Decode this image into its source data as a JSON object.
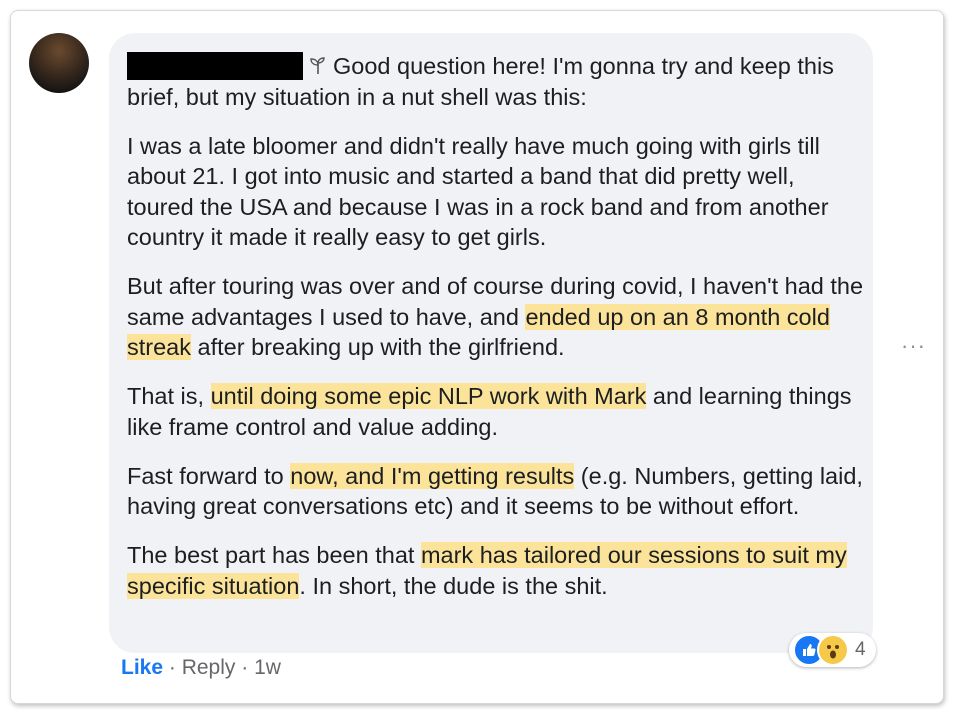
{
  "comment": {
    "author_redacted": true,
    "badge_icon": "sprout-icon",
    "paragraphs": [
      [
        {
          "text": "Good question here! I'm gonna try and keep this brief, but my situation in a nut shell was this:",
          "hl": false
        }
      ],
      [
        {
          "text": "I was a late bloomer and didn't really have much going with girls till about 21. I got into music and started a band that did pretty well, toured the USA and because I was in a rock band and from another country it made it really easy to get girls.",
          "hl": false
        }
      ],
      [
        {
          "text": "But after touring was over and of course during covid, I haven't had the same advantages I used to have, and ",
          "hl": false
        },
        {
          "text": "ended up on an 8 month cold streak",
          "hl": true
        },
        {
          "text": " after breaking up with the girlfriend.",
          "hl": false
        }
      ],
      [
        {
          "text": "That is, ",
          "hl": false
        },
        {
          "text": "until doing some epic NLP work with Mark",
          "hl": true
        },
        {
          "text": " and learning things like frame control and value adding.",
          "hl": false
        }
      ],
      [
        {
          "text": "Fast forward to ",
          "hl": false
        },
        {
          "text": "now, and I'm getting results",
          "hl": true
        },
        {
          "text": " (e.g. Numbers, getting laid, having great conversations etc) and it seems to be without effort.",
          "hl": false
        }
      ],
      [
        {
          "text": "The best part has been that ",
          "hl": false
        },
        {
          "text": "mark has tailored our sessions to suit my specific situation",
          "hl": true
        },
        {
          "text": ". In short, the dude is the shit.",
          "hl": false
        }
      ]
    ],
    "highlight_color": "#fbe49a"
  },
  "actions": {
    "like": "Like",
    "sep1": " · ",
    "reply": "Reply",
    "sep2": " · ",
    "time": "1w"
  },
  "more_options": "···",
  "reactions": {
    "icons": [
      "like-reaction-icon",
      "wow-reaction-icon"
    ],
    "count": "4"
  },
  "colors": {
    "bubble": "#f0f2f5",
    "link_blue": "#1877f2",
    "meta_gray": "#65676b"
  }
}
